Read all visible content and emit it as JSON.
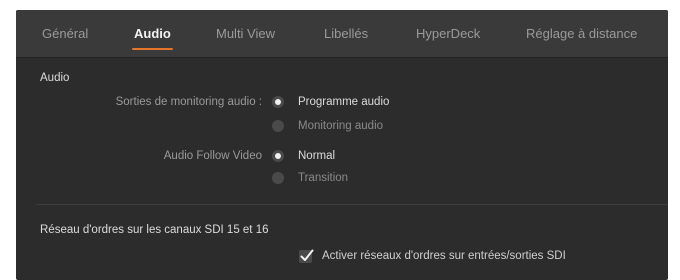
{
  "tabs": [
    {
      "label": "Général",
      "active": false
    },
    {
      "label": "Audio",
      "active": true
    },
    {
      "label": "Multi View",
      "active": false
    },
    {
      "label": "Libellés",
      "active": false
    },
    {
      "label": "HyperDeck",
      "active": false
    },
    {
      "label": "Réglage à distance",
      "active": false
    }
  ],
  "audio_section": {
    "title": "Audio",
    "monitoring": {
      "label": "Sorties de monitoring audio :",
      "options": [
        {
          "label": "Programme audio",
          "selected": true
        },
        {
          "label": "Monitoring audio",
          "selected": false
        }
      ]
    },
    "afv": {
      "label": "Audio Follow Video",
      "options": [
        {
          "label": "Normal",
          "selected": true
        },
        {
          "label": "Transition",
          "selected": false
        }
      ]
    }
  },
  "talkback_section": {
    "title": "Réseau d'ordres sur les canaux SDI 15 et 16",
    "checkbox": {
      "label": "Activer réseaux d'ordres sur entrées/sorties SDI",
      "checked": true
    }
  },
  "colors": {
    "panel": "#2c2c2c",
    "tabbar": "#3a3a3a",
    "accent": "#e8742c"
  }
}
